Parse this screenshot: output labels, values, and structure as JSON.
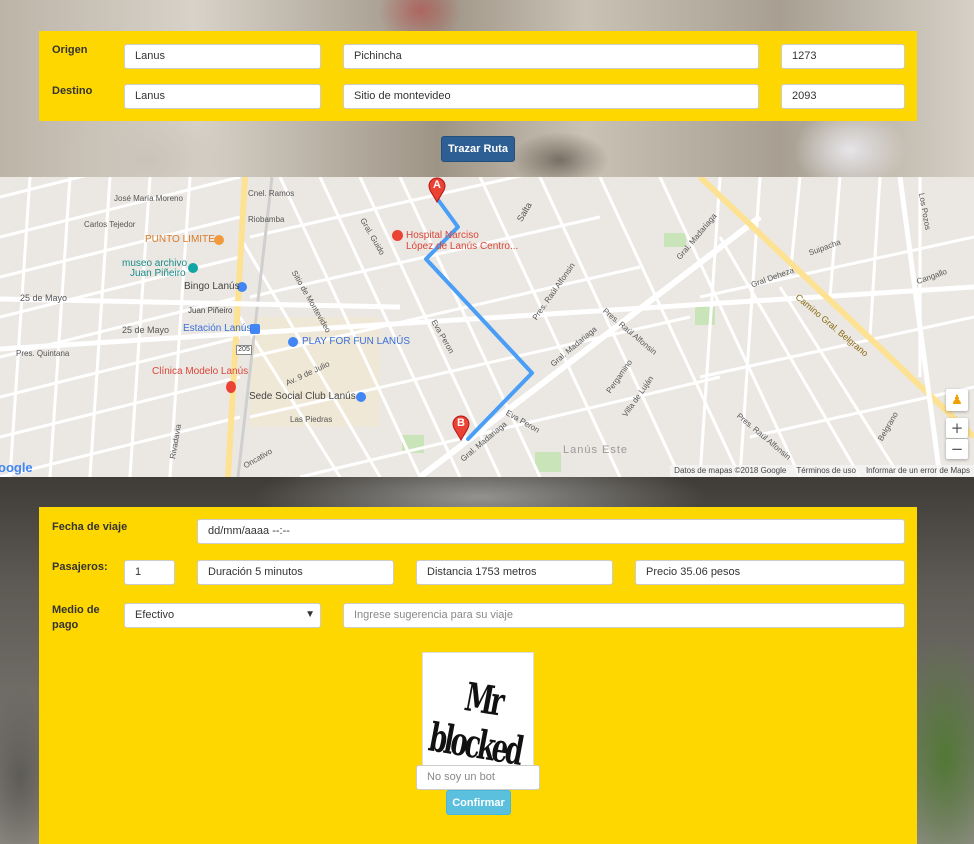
{
  "route_form": {
    "origen_label": "Origen",
    "destino_label": "Destino",
    "origen": {
      "city": "Lanus",
      "street": "Pichincha",
      "number": "1273"
    },
    "destino": {
      "city": "Lanus",
      "street": "Sitio de montevideo",
      "number": "2093"
    },
    "trace_button": "Trazar Ruta"
  },
  "map": {
    "marker_a": "A",
    "marker_b": "B",
    "places": [
      {
        "id": "hospital1",
        "text": "Hospital Narciso"
      },
      {
        "id": "hospital2",
        "text": "López de Lanús Centro..."
      },
      {
        "id": "punto",
        "text": "PUNTO LIMITE"
      },
      {
        "id": "museo1",
        "text": "museo archivo"
      },
      {
        "id": "museo2",
        "text": "Juan Piñeiro"
      },
      {
        "id": "bingo",
        "text": "Bingo Lanús"
      },
      {
        "id": "juanp",
        "text": "Juan Piñeiro"
      },
      {
        "id": "estacion",
        "text": "Estación Lanús"
      },
      {
        "id": "play",
        "text": "PLAY FOR FUN LANÚS"
      },
      {
        "id": "clinica",
        "text": "Clínica Modelo Lanús"
      },
      {
        "id": "sede",
        "text": "Sede Social Club Lanús"
      },
      {
        "id": "lanuseste",
        "text": "Lanús Este"
      },
      {
        "id": "camino",
        "text": "Camino Gral. Belgrano"
      },
      {
        "id": "25mayo1",
        "text": "25 de Mayo"
      },
      {
        "id": "25mayo2",
        "text": "25 de Mayo"
      },
      {
        "id": "salta",
        "text": "Salta"
      },
      {
        "id": "guido",
        "text": "Gral. Guido"
      },
      {
        "id": "evaperon1",
        "text": "Eva Peron"
      },
      {
        "id": "evaperon2",
        "text": "Eva Peron"
      },
      {
        "id": "alfonsin1",
        "text": "Pres. Raúl Alfonsin"
      },
      {
        "id": "alfonsin2",
        "text": "Pres. Raúl Alfonsin"
      },
      {
        "id": "alfonsin3",
        "text": "Pres. Raúl Alfonsin"
      },
      {
        "id": "madariaga1",
        "text": "Gral. Madariaga"
      },
      {
        "id": "madariaga2",
        "text": "Gral. Madariaga"
      },
      {
        "id": "madariaga3",
        "text": "Gral. Madariaga"
      },
      {
        "id": "pergamino",
        "text": "Pergamino"
      },
      {
        "id": "villalujan",
        "text": "Villa de Luján"
      },
      {
        "id": "deheza",
        "text": "Gral Deheza"
      },
      {
        "id": "supacha",
        "text": "Suipacha"
      },
      {
        "id": "cangallo",
        "text": "Cangallo"
      },
      {
        "id": "lospozos",
        "text": "Los Pozos"
      },
      {
        "id": "oncativo",
        "text": "Oncativo"
      },
      {
        "id": "rivadavia",
        "text": "Rivadavia"
      },
      {
        "id": "sitio",
        "text": "Sitio de Montevideo"
      },
      {
        "id": "ramos",
        "text": "Cnel. Ramos"
      },
      {
        "id": "riobamba",
        "text": "Riobamba"
      },
      {
        "id": "av9julio",
        "text": "Av. 9 de Julio"
      },
      {
        "id": "carlos",
        "text": "Carlos Tejedor"
      },
      {
        "id": "moreno",
        "text": "José María Moreno"
      },
      {
        "id": "quintana",
        "text": "Pres. Quintana"
      },
      {
        "id": "piedras",
        "text": "Las Piedras"
      },
      {
        "id": "belgrano2",
        "text": "Belgrano"
      },
      {
        "id": "route205",
        "text": "205"
      }
    ],
    "zoom_in": "+",
    "zoom_out": "−",
    "logo": "oogle",
    "attribution": [
      "Datos de mapas ©2018 Google",
      "Términos de uso",
      "Informar de un error de Maps"
    ]
  },
  "trip_form": {
    "fecha_label": "Fecha de viaje",
    "fecha_value": "dd/mm/aaaa --:--",
    "pasajeros_label": "Pasajeros:",
    "pasajeros_value": "1",
    "duracion": "Duración 5 minutos",
    "distancia": "Distancia 1753 metros",
    "precio": "Precio 35.06 pesos",
    "medio_label_1": "Medio de",
    "medio_label_2": "pago",
    "medio_value": "Efectivo",
    "sugerencia_placeholder": "Ingrese sugerencia para su viaje",
    "captcha_text": "Mr blocked",
    "bot_placeholder": "No soy un bot",
    "confirm_button": "Confirmar"
  },
  "colors": {
    "panel": "#ffd700",
    "route_button": "#2e5f94",
    "confirm_button": "#5bc0de",
    "route_line": "#4a9ef5",
    "marker": "#ea4335"
  }
}
